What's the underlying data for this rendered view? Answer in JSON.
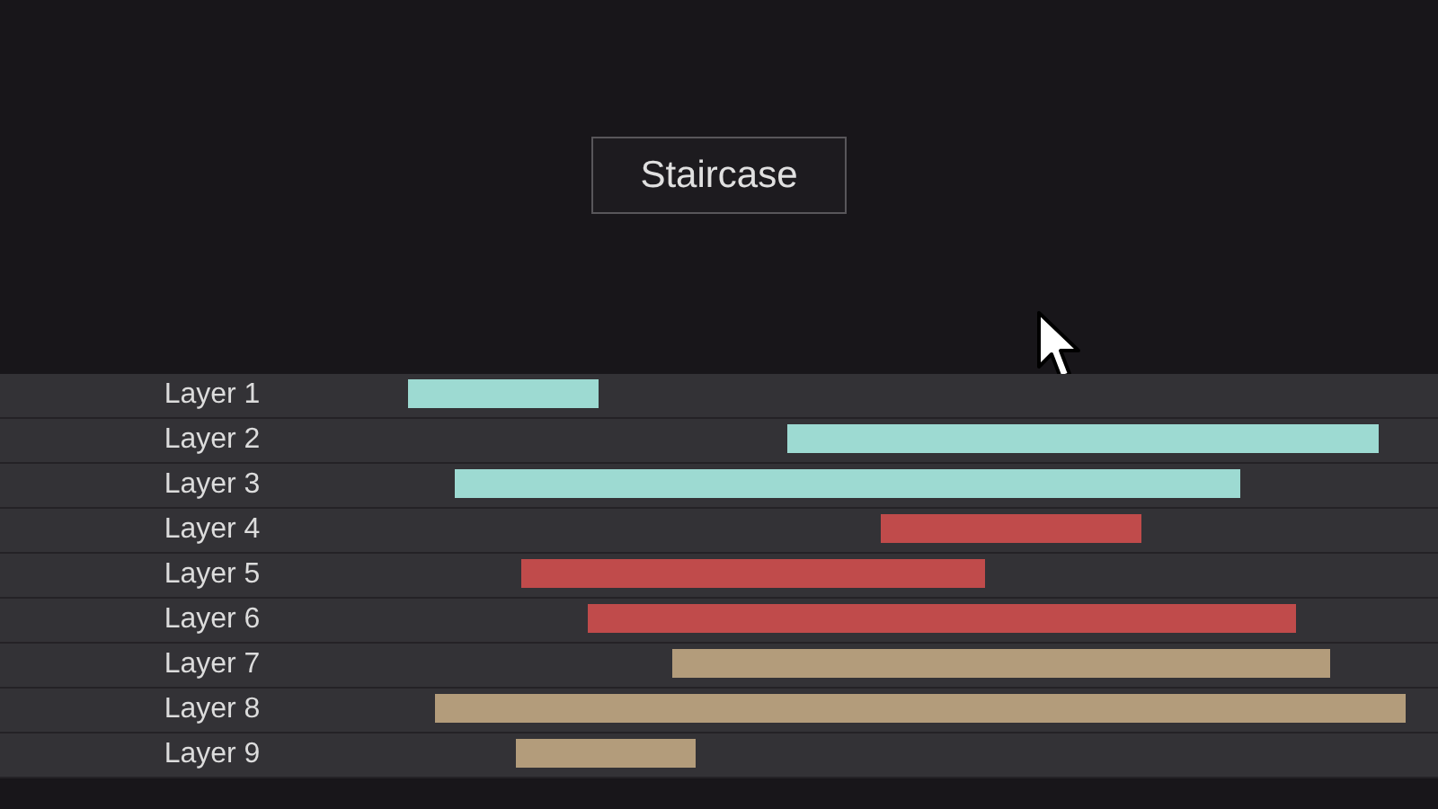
{
  "title_button": {
    "label": "Staircase"
  },
  "layers": [
    {
      "label": "Layer 1",
      "color": "#9ddad2"
    },
    {
      "label": "Layer 2",
      "color": "#9ddad2"
    },
    {
      "label": "Layer 3",
      "color": "#9ddad2"
    },
    {
      "label": "Layer 4",
      "color": "#c04b4b"
    },
    {
      "label": "Layer 5",
      "color": "#c04b4b"
    },
    {
      "label": "Layer 6",
      "color": "#c04b4b"
    },
    {
      "label": "Layer 7",
      "color": "#b39c7b"
    },
    {
      "label": "Layer 8",
      "color": "#b39c7b"
    },
    {
      "label": "Layer 9",
      "color": "#b39c7b"
    }
  ]
}
